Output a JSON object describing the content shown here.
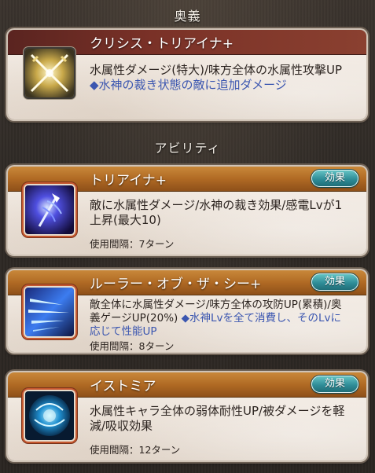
{
  "sections": {
    "ougi_header": "奥義",
    "ability_header": "アビリティ"
  },
  "ougi": {
    "name": "クリシス・トリアイナ+",
    "description": "水属性ダメージ(特大)/味方全体の水属性攻撃UP",
    "note": "◆水神の裁き状態の敵に追加ダメージ",
    "icon": "crossed-swords-icon"
  },
  "abilities": [
    {
      "name": "トリアイナ+",
      "effect_label": "効果",
      "description": "敵に水属性ダメージ/水神の裁き効果/感電Lvが1上昇(最大10)",
      "note": "",
      "cooldown": "使用間隔：7ターン",
      "icon": "trident-icon"
    },
    {
      "name": "ルーラー・オブ・ザ・シー+",
      "effect_label": "効果",
      "description": "敵全体に水属性ダメージ/味方全体の攻防UP(累積)/奥義ゲージUP(20%)",
      "note": "◆水神Lvを全て消費し、そのLvに応じて性能UP",
      "cooldown": "使用間隔：8ターン",
      "icon": "water-spears-icon"
    },
    {
      "name": "イストミア",
      "effect_label": "効果",
      "description": "水属性キャラ全体の弱体耐性UP/被ダメージを軽減/吸収効果",
      "note": "",
      "cooldown": "使用間隔：12ターン",
      "icon": "water-orb-icon"
    }
  ],
  "colors": {
    "ougi_title_bg": "#7a3127",
    "ability_title_bg": "#b06a24",
    "note_text": "#3b56b0",
    "effect_button": "#2f8d98"
  }
}
